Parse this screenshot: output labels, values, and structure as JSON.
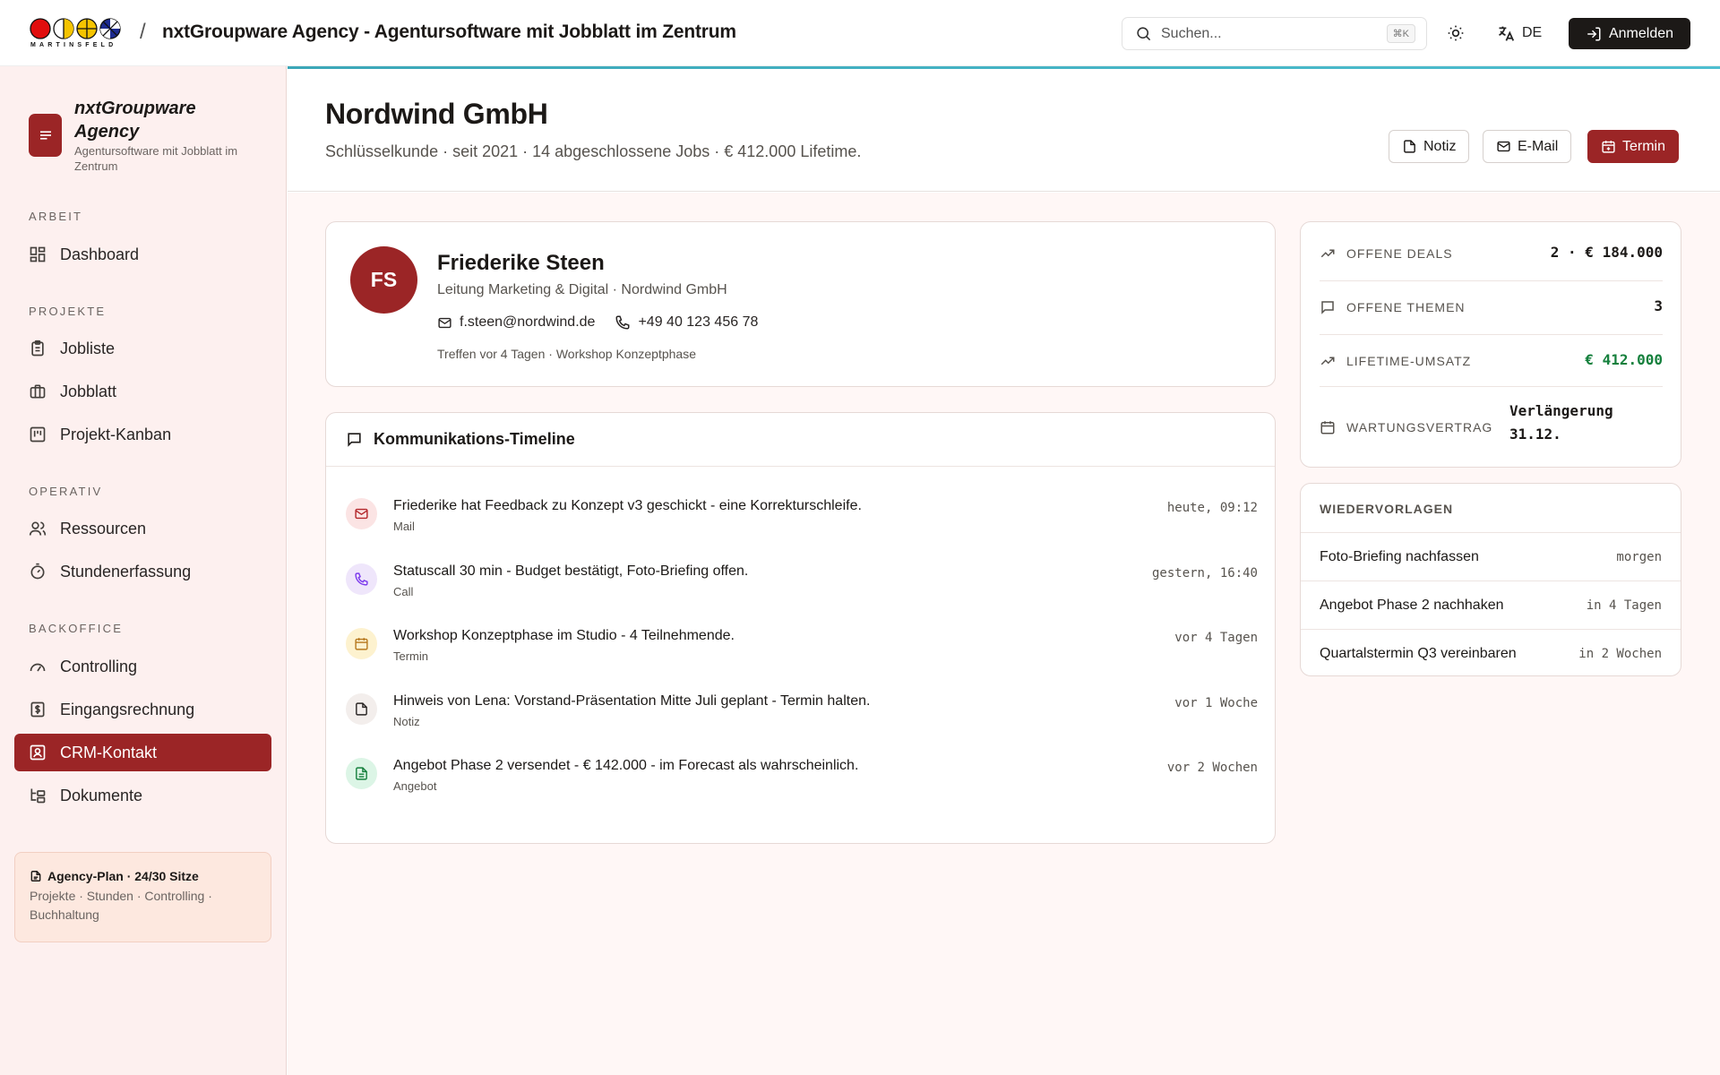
{
  "topbar": {
    "logo_text": "MARTINSFELD",
    "separator": "/",
    "app_title": "nxtGroupware Agency - Agentursoftware mit Jobblatt im Zentrum",
    "search_placeholder": "Suchen...",
    "search_shortcut": "⌘K",
    "language": "DE",
    "login_label": "Anmelden"
  },
  "sidebar": {
    "brand_name": "nxtGroupware Agency",
    "brand_sub": "Agentursoftware mit Jobblatt im Zentrum",
    "sections": {
      "arbeit": "ARBEIT",
      "projekte": "PROJEKTE",
      "operativ": "OPERATIV",
      "backoffice": "BACKOFFICE"
    },
    "items": {
      "dashboard": "Dashboard",
      "jobliste": "Jobliste",
      "jobblatt": "Jobblatt",
      "kanban": "Projekt-Kanban",
      "ressourcen": "Ressourcen",
      "stunden": "Stundenerfassung",
      "controlling": "Controlling",
      "eingangsrechnung": "Eingangsrechnung",
      "crm": "CRM-Kontakt",
      "dokumente": "Dokumente"
    },
    "active_item": "crm",
    "plan": {
      "title": "Agency-Plan · 24/30 Sitze",
      "sub": "Projekte · Stunden · Controlling · Buchhaltung"
    }
  },
  "header": {
    "company": "Nordwind GmbH",
    "subtitle": "Schlüsselkunde · seit 2021 · 14 abgeschlossene Jobs · € 412.000 Lifetime.",
    "buttons": {
      "note": "Notiz",
      "email": "E-Mail",
      "appointment": "Termin"
    }
  },
  "contact": {
    "initials": "FS",
    "name": "Friederike Steen",
    "role": "Leitung Marketing & Digital · Nordwind GmbH",
    "email": "f.steen@nordwind.de",
    "phone": "+49 40 123 456 78",
    "meta": "Treffen vor 4 Tagen · Workshop Konzeptphase"
  },
  "timeline": {
    "title": "Kommunikations-Timeline",
    "entries": [
      {
        "text": "Friederike hat Feedback zu Konzept v3 geschickt - eine Korrekturschleife.",
        "type": "Mail",
        "time": "heute, 09:12",
        "icon": "mail-icon",
        "bg": "#fbe4e4",
        "fg": "#b3262a"
      },
      {
        "text": "Statuscall 30 min - Budget bestätigt, Foto-Briefing offen.",
        "type": "Call",
        "time": "gestern, 16:40",
        "icon": "phone-icon",
        "bg": "#efe6fb",
        "fg": "#7c3aed"
      },
      {
        "text": "Workshop Konzeptphase im Studio - 4 Teilnehmende.",
        "type": "Termin",
        "time": "vor 4 Tagen",
        "icon": "calendar-icon",
        "bg": "#fdf2cf",
        "fg": "#b7791f"
      },
      {
        "text": "Hinweis von Lena: Vorstand-Präsentation Mitte Juli geplant - Termin halten.",
        "type": "Notiz",
        "time": "vor 1 Woche",
        "icon": "note-icon",
        "bg": "#f3eeec",
        "fg": "#292524"
      },
      {
        "text": "Angebot Phase 2 versendet - € 142.000 - im Forecast als wahrscheinlich.",
        "type": "Angebot",
        "time": "vor 2 Wochen",
        "icon": "document-icon",
        "bg": "#dcf5e6",
        "fg": "#15803d"
      }
    ]
  },
  "stats": {
    "deals_label": "OFFENE DEALS",
    "deals_value": "2 · € 184.000",
    "themes_label": "OFFENE THEMEN",
    "themes_value": "3",
    "revenue_label": "LIFETIME-UMSATZ",
    "revenue_value": "€ 412.000",
    "revenue_color": "#15803d",
    "contract_label": "WARTUNGSVERTRAG",
    "contract_value_line1": "Verlängerung",
    "contract_value_line2": "31.12."
  },
  "wiedervorlagen": {
    "title": "WIEDERVORLAGEN",
    "items": [
      {
        "title": "Foto-Briefing nachfassen",
        "time": "morgen"
      },
      {
        "title": "Angebot Phase 2 nachhaken",
        "time": "in 4 Tagen"
      },
      {
        "title": "Quartalstermin Q3 vereinbaren",
        "time": "in 2 Wochen"
      }
    ]
  },
  "colors": {
    "brand": "#9b2526",
    "accent_line": "#3ba7b8",
    "sidebar_bg": "#fdf0ef"
  }
}
